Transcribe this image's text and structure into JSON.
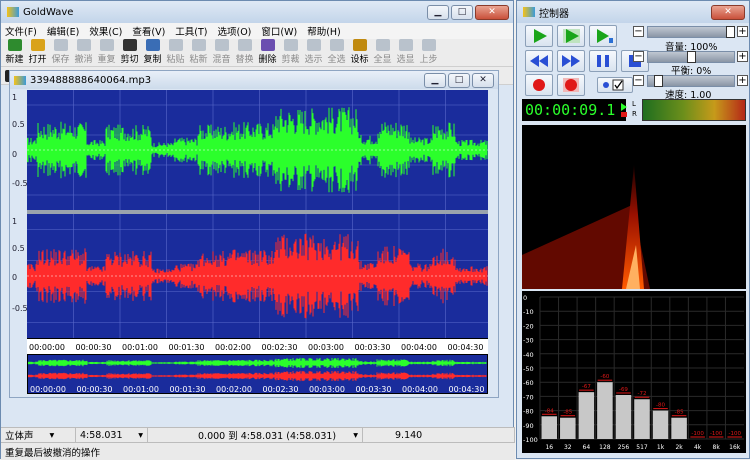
{
  "main_window": {
    "title": "GoldWave",
    "menu": [
      "文件(F)",
      "编辑(E)",
      "效果(C)",
      "查看(V)",
      "工具(T)",
      "选项(O)",
      "窗口(W)",
      "帮助(H)"
    ],
    "toolbar": [
      {
        "label": "新建",
        "enabled": true
      },
      {
        "label": "打开",
        "enabled": true
      },
      {
        "label": "保存",
        "enabled": false
      },
      {
        "label": "撤消",
        "enabled": false
      },
      {
        "label": "重复",
        "enabled": false
      },
      {
        "label": "剪切",
        "enabled": true
      },
      {
        "label": "复制",
        "enabled": true
      },
      {
        "label": "粘贴",
        "enabled": false
      },
      {
        "label": "粘新",
        "enabled": false
      },
      {
        "label": "混音",
        "enabled": false
      },
      {
        "label": "替换",
        "enabled": false
      },
      {
        "label": "删除",
        "enabled": true
      },
      {
        "label": "剪裁",
        "enabled": false
      },
      {
        "label": "选示",
        "enabled": false
      },
      {
        "label": "全选",
        "enabled": false
      },
      {
        "label": "设标",
        "enabled": true
      },
      {
        "label": "全显",
        "enabled": false
      },
      {
        "label": "选显",
        "enabled": false
      },
      {
        "label": "上步",
        "enabled": false
      }
    ]
  },
  "document": {
    "title": "339488888640064.mp3",
    "y_labels_top": [
      "1",
      "0.5",
      "0",
      "-0.5"
    ],
    "y_labels_bottom": [
      "1",
      "0.5",
      "0",
      "-0.5"
    ],
    "timeline": [
      "00:00:00",
      "00:00:30",
      "00:01:00",
      "00:01:30",
      "00:02:00",
      "00:02:30",
      "00:03:00",
      "00:03:30",
      "00:04:00",
      "00:04:30"
    ],
    "overview_timeline": [
      "00:00:00",
      "00:00:30",
      "00:01:00",
      "00:01:30",
      "00:02:00",
      "00:02:30",
      "00:03:00",
      "00:03:30",
      "00:04:00",
      "00:04:30"
    ],
    "colors": {
      "background": "#1a2c9c",
      "left_channel": "#2bff2b",
      "right_channel": "#ff2b2b"
    }
  },
  "status": {
    "channel": "立体声",
    "length": "4:58.031",
    "selection": "0.000 到 4:58.031 (4:58.031)",
    "position": "9.140",
    "message": "重复最后被撤消的操作"
  },
  "control": {
    "title": "控制器",
    "volume_label": "音量: 100%",
    "balance_label": "平衡: 0%",
    "speed_label": "速度: 1.00",
    "volume_level": 1.0,
    "balance_level": 0.5,
    "speed_level": 0.08,
    "time": "00:00:09.1",
    "meter_letters": [
      "L",
      "R"
    ],
    "eq_y_labels": [
      "0",
      "-10",
      "-20",
      "-30",
      "-40",
      "-50",
      "-60",
      "-70",
      "-80",
      "-90",
      "-100"
    ],
    "eq_bands": [
      "16",
      "32",
      "64",
      "128",
      "256",
      "517",
      "1k",
      "2k",
      "4k",
      "8k",
      "16k"
    ],
    "eq_bar_labels": [
      "-84",
      "-85",
      "-67",
      "-60",
      "-69",
      "-72",
      "-80",
      "-85",
      "-100",
      "-100",
      "-100"
    ]
  }
}
